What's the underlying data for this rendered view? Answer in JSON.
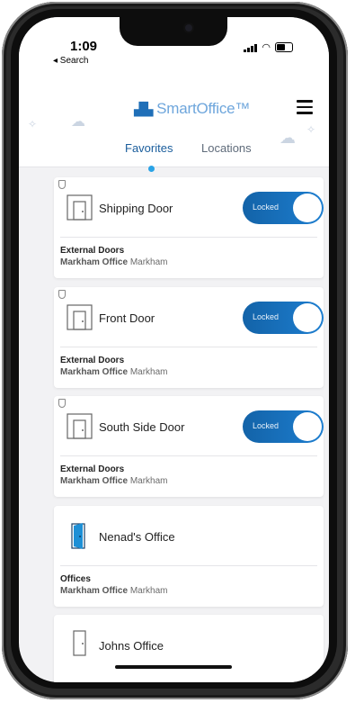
{
  "status_bar": {
    "time": "1:09",
    "back_label": "◂ Search"
  },
  "app": {
    "name": "SmartOffice™"
  },
  "tabs": [
    {
      "label": "Favorites",
      "active": true
    },
    {
      "label": "Locations",
      "active": false
    }
  ],
  "doors": [
    {
      "name": "Shipping Door",
      "group": "External Doors",
      "office": "Markham Office",
      "city": "Markham",
      "toggle": "Locked",
      "icon": "door-icon"
    },
    {
      "name": "Front Door",
      "group": "External Doors",
      "office": "Markham Office",
      "city": "Markham",
      "toggle": "Locked",
      "icon": "door-icon"
    },
    {
      "name": "South Side Door",
      "group": "External Doors",
      "office": "Markham Office",
      "city": "Markham",
      "toggle": "Locked",
      "icon": "door-icon"
    },
    {
      "name": "Nenad's Office",
      "group": "Offices",
      "office": "Markham Office",
      "city": "Markham",
      "icon": "open-door-icon"
    },
    {
      "name": "Johns Office",
      "icon": "door-icon"
    }
  ],
  "colors": {
    "accent": "#1d7ed0",
    "tab_active": "#1a5d9c",
    "dot": "#2aa3e6"
  }
}
